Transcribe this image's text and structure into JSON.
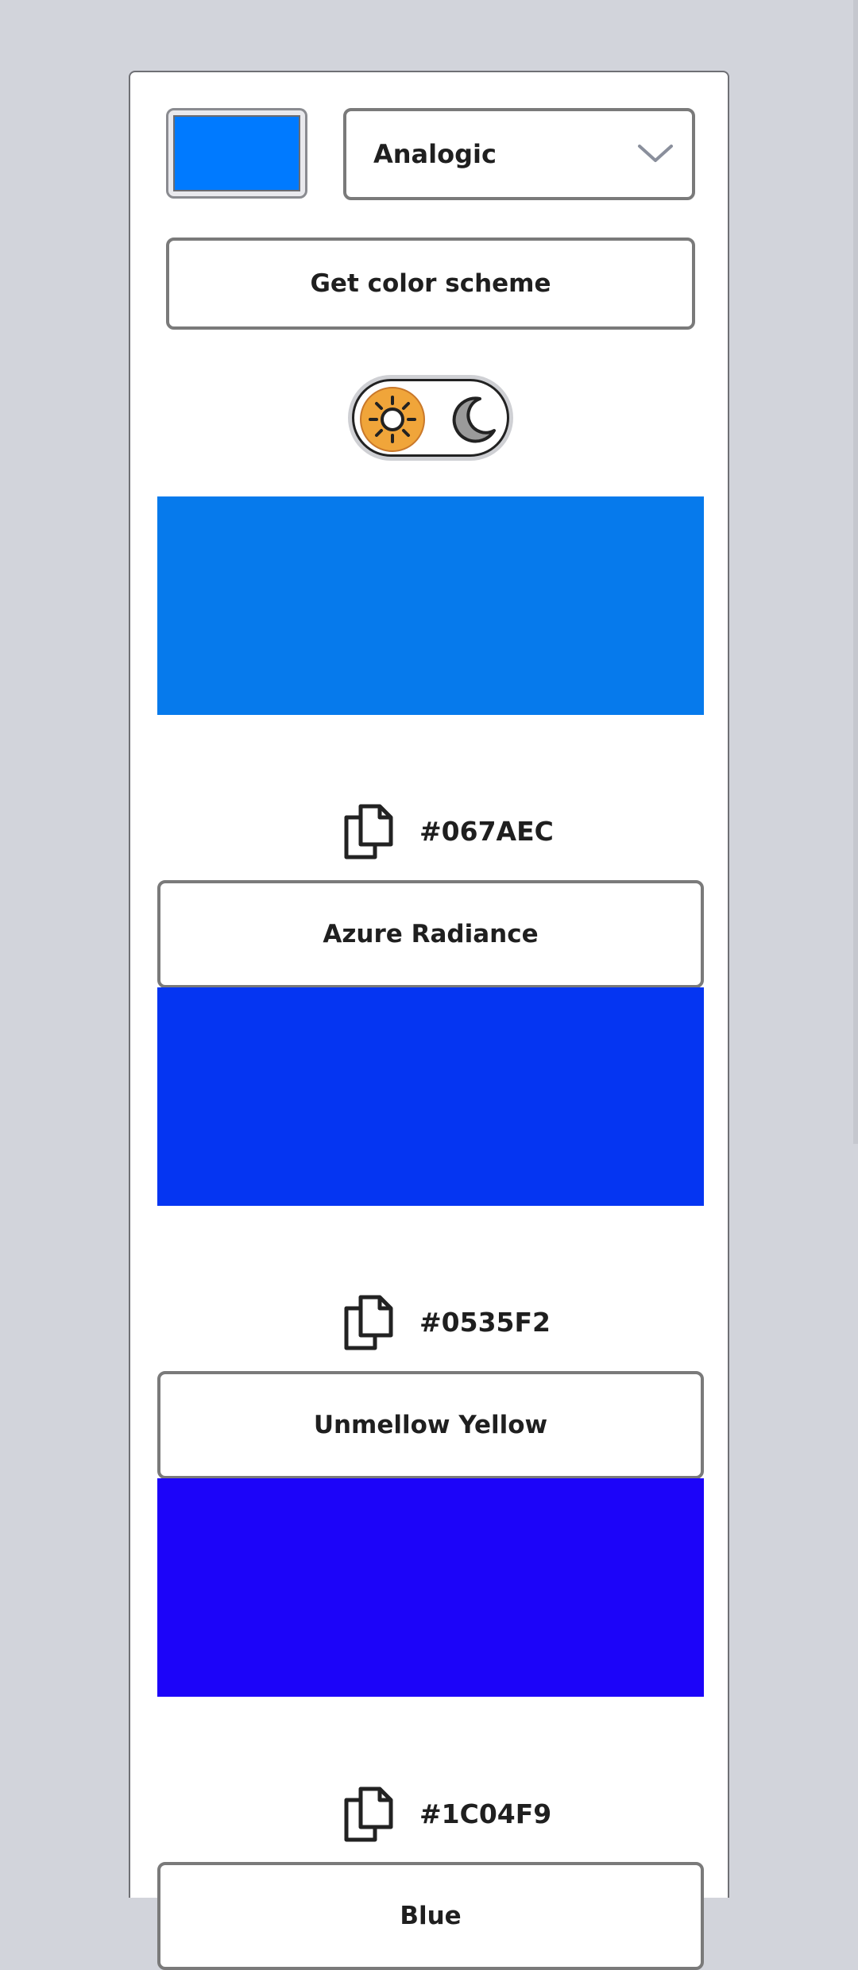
{
  "seed": {
    "color": "#007AFF"
  },
  "mode_select": {
    "value": "Analogic"
  },
  "get_button": {
    "label": "Get color scheme"
  },
  "theme_toggle": {
    "state": "light"
  },
  "colors": [
    {
      "hex": "#067AEC",
      "name": "Azure Radiance"
    },
    {
      "hex": "#0535F2",
      "name": "Unmellow Yellow"
    },
    {
      "hex": "#1C04F9",
      "name": "Blue"
    }
  ]
}
